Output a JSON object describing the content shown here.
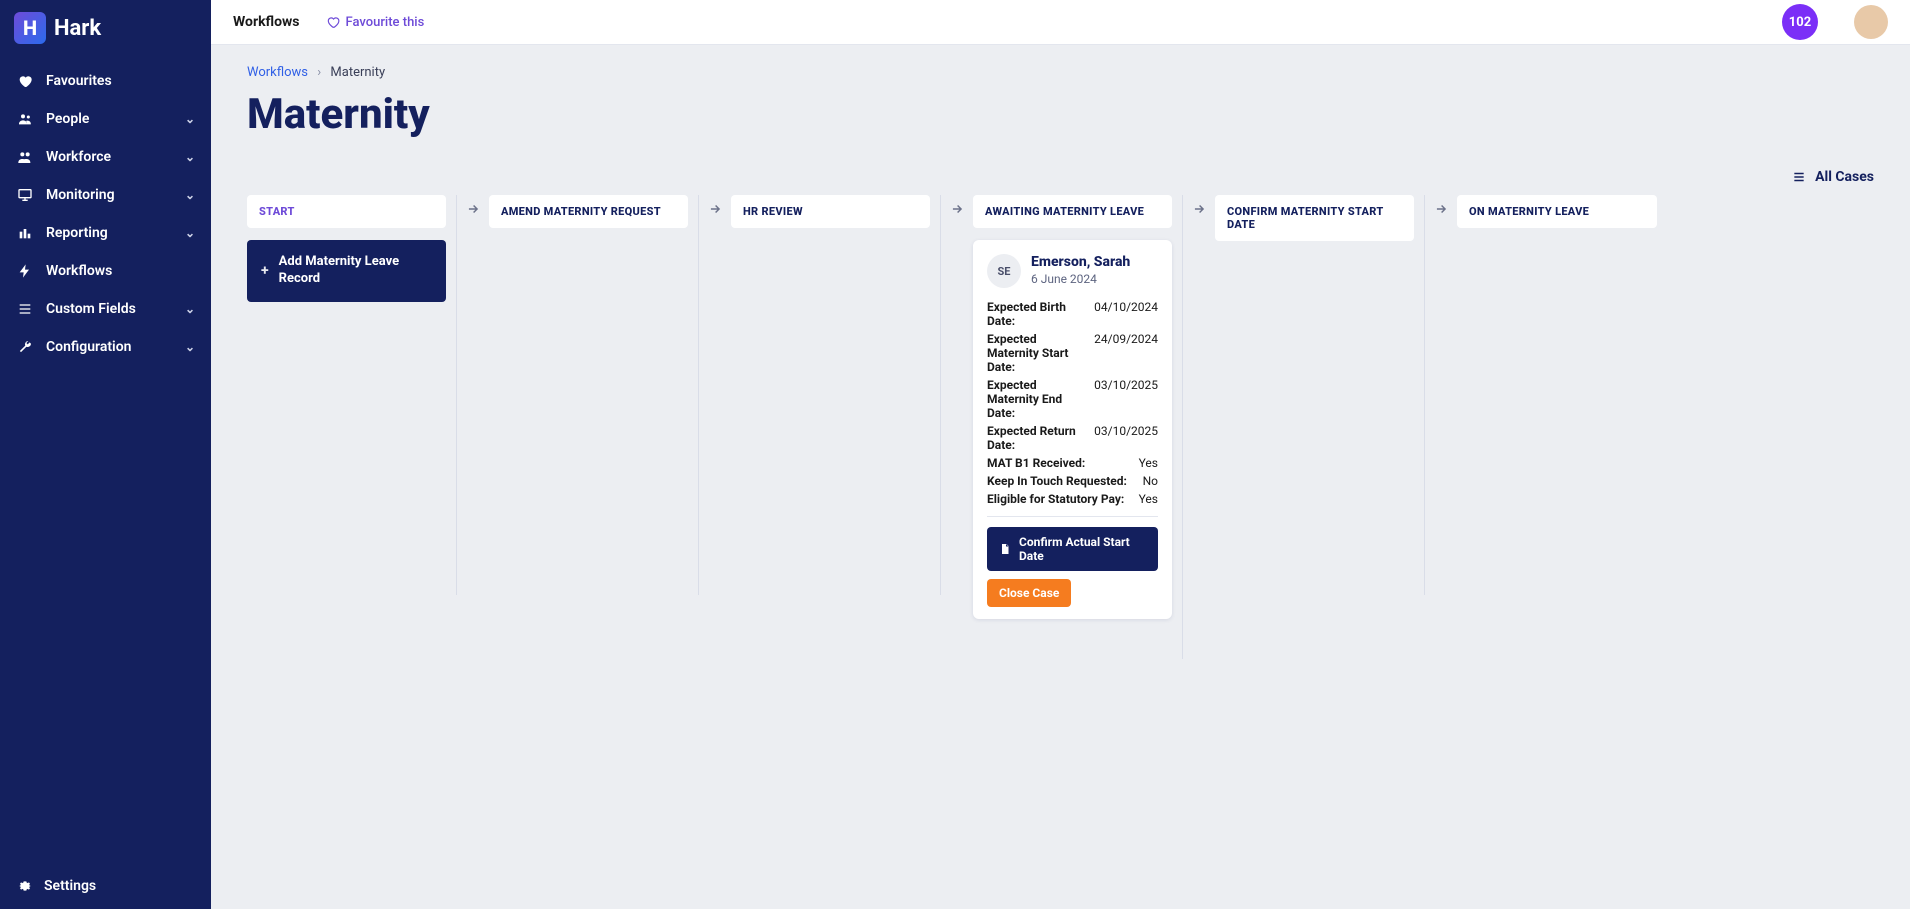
{
  "brand": "Hark",
  "sidebar": {
    "items": [
      {
        "label": "Favourites",
        "icon": "heart",
        "expandable": false
      },
      {
        "label": "People",
        "icon": "people",
        "expandable": true
      },
      {
        "label": "Workforce",
        "icon": "group",
        "expandable": true
      },
      {
        "label": "Monitoring",
        "icon": "monitor",
        "expandable": true
      },
      {
        "label": "Reporting",
        "icon": "chart",
        "expandable": true
      },
      {
        "label": "Workflows",
        "icon": "bolt",
        "expandable": false
      },
      {
        "label": "Custom Fields",
        "icon": "list",
        "expandable": true
      },
      {
        "label": "Configuration",
        "icon": "wrench",
        "expandable": true
      }
    ],
    "settings_label": "Settings"
  },
  "topbar": {
    "title": "Workflows",
    "favourite_label": "Favourite this",
    "badge": "102"
  },
  "breadcrumb": {
    "parent": "Workflows",
    "current": "Maternity"
  },
  "page_title": "Maternity",
  "all_cases_label": "All Cases",
  "columns": [
    {
      "label": "START",
      "active": true
    },
    {
      "label": "AMEND MATERNITY REQUEST"
    },
    {
      "label": "HR REVIEW"
    },
    {
      "label": "AWAITING MATERNITY LEAVE"
    },
    {
      "label": "CONFIRM MATERNITY START DATE"
    },
    {
      "label": "ON MATERNITY LEAVE"
    }
  ],
  "start_button_label": "Add Maternity Leave Record",
  "case": {
    "initials": "SE",
    "name": "Emerson, Sarah",
    "date": "6 June 2024",
    "fields": [
      {
        "k": "Expected Birth Date:",
        "v": "04/10/2024"
      },
      {
        "k": "Expected Maternity Start Date:",
        "v": "24/09/2024"
      },
      {
        "k": "Expected Maternity End Date:",
        "v": "03/10/2025"
      },
      {
        "k": "Expected Return Date:",
        "v": "03/10/2025"
      },
      {
        "k": "MAT B1 Received:",
        "v": "Yes"
      },
      {
        "k": "Keep In Touch Requested:",
        "v": "No"
      },
      {
        "k": "Eligible for Statutory Pay:",
        "v": "Yes"
      }
    ],
    "primary_action": "Confirm Actual Start Date",
    "close_action": "Close Case"
  }
}
